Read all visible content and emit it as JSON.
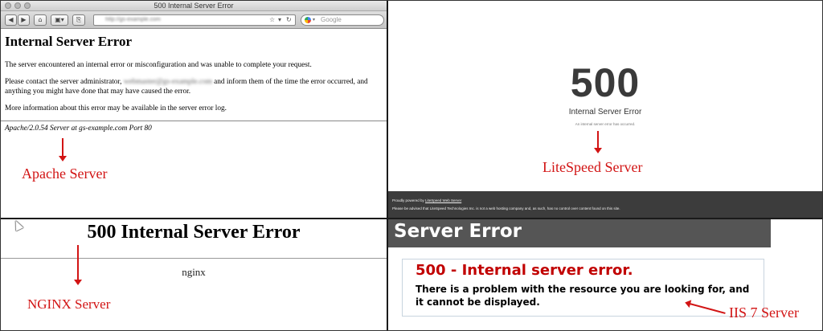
{
  "colors": {
    "annotation_red": "#d21414",
    "iis_error_red": "#c10000",
    "iis_header_bg": "#555555",
    "litespeed_footer_bg": "#3c3c3c"
  },
  "apache": {
    "window_title": "500 Internal Server Error",
    "url": "http://gs-example.com",
    "search_placeholder": "Google",
    "heading": "Internal Server Error",
    "paragraph1": "The server encountered an internal error or misconfiguration and was unable to complete your request.",
    "paragraph2_before": "Please contact the server administrator, ",
    "paragraph2_email": "webmaster@gs-example.com",
    "paragraph2_after": " and inform them of the time the error occurred, and anything you might have done that may have caused the error.",
    "paragraph3": "More information about this error may be available in the server error log.",
    "signature": "Apache/2.0.54 Server at gs-example.com Port 80",
    "label": "Apache Server"
  },
  "litespeed": {
    "code": "500",
    "title": "Internal Server Error",
    "subtitle": "An internal server error has occurred.",
    "footer_prefix": "Proudly powered by ",
    "footer_link": "LiteSpeed Web Server",
    "footer_notice": "Please be advised that LiteSpeed Technologies Inc. is not a web hosting company and, as such, has no control over content found on this site.",
    "label": "LiteSpeed Server"
  },
  "nginx": {
    "title": "500 Internal Server Error",
    "server_name": "nginx",
    "label": "NGINX Server"
  },
  "iis": {
    "header": "Server Error",
    "error_title": "500 - Internal server error.",
    "error_description": "There is a problem with the resource you are looking for, and it cannot be displayed.",
    "label": "IIS 7 Server"
  }
}
